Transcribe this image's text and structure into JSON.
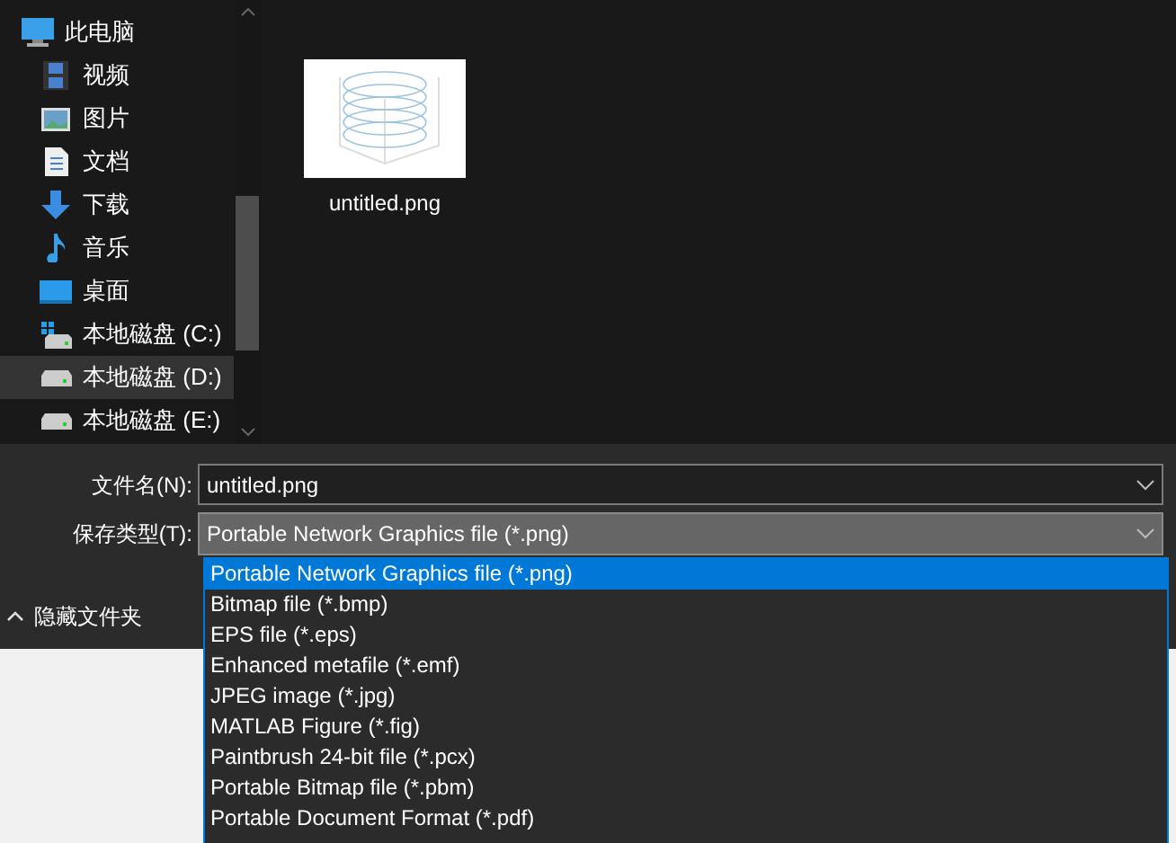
{
  "nav": {
    "items": [
      {
        "label": "此电脑",
        "kind": "computer",
        "selected": false,
        "children": [
          {
            "label": "视频",
            "kind": "video",
            "selected": false
          },
          {
            "label": "图片",
            "kind": "picture",
            "selected": false
          },
          {
            "label": "文档",
            "kind": "document",
            "selected": false
          },
          {
            "label": "下载",
            "kind": "download",
            "selected": false
          },
          {
            "label": "音乐",
            "kind": "music",
            "selected": false
          },
          {
            "label": "桌面",
            "kind": "desktop",
            "selected": false
          },
          {
            "label": "本地磁盘 (C:)",
            "kind": "system-drive",
            "selected": false
          },
          {
            "label": "本地磁盘 (D:)",
            "kind": "drive",
            "selected": true
          },
          {
            "label": "本地磁盘 (E:)",
            "kind": "drive",
            "selected": false
          }
        ]
      }
    ]
  },
  "files": [
    {
      "name": "untitled.png"
    }
  ],
  "filename": {
    "label": "文件名(N):",
    "value": "untitled.png"
  },
  "filetype": {
    "label": "保存类型(T):",
    "value": "Portable Network Graphics file (*.png)",
    "expanded": true,
    "options": [
      {
        "label": "Portable Network Graphics file (*.png)",
        "selected": true
      },
      {
        "label": "Bitmap file (*.bmp)",
        "selected": false
      },
      {
        "label": "EPS file (*.eps)",
        "selected": false
      },
      {
        "label": "Enhanced metafile (*.emf)",
        "selected": false
      },
      {
        "label": "JPEG image (*.jpg)",
        "selected": false
      },
      {
        "label": "MATLAB Figure (*.fig)",
        "selected": false
      },
      {
        "label": "Paintbrush 24-bit file (*.pcx)",
        "selected": false
      },
      {
        "label": "Portable Bitmap file (*.pbm)",
        "selected": false
      },
      {
        "label": "Portable Document Format (*.pdf)",
        "selected": false
      }
    ]
  },
  "hide_folders": {
    "label": "隐藏文件夹"
  }
}
